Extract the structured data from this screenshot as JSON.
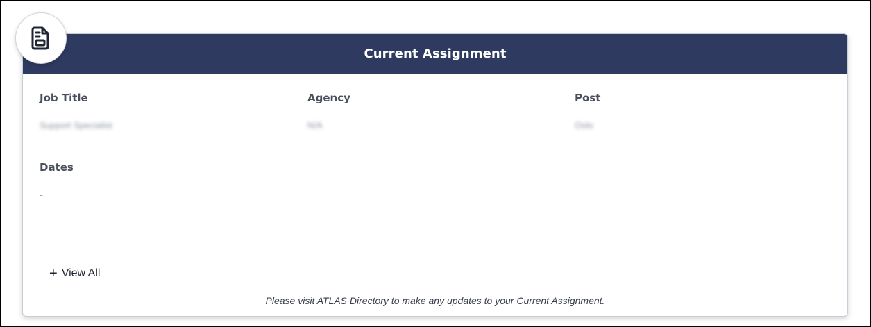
{
  "card": {
    "title": "Current Assignment",
    "icon": "document-icon",
    "header_color": "#2e3a60"
  },
  "fields": {
    "job_title": {
      "label": "Job Title",
      "value": "Support Specialist"
    },
    "agency": {
      "label": "Agency",
      "value": "N/A"
    },
    "post": {
      "label": "Post",
      "value": "Oslo"
    },
    "dates": {
      "label": "Dates",
      "value": "-"
    }
  },
  "footer": {
    "view_all_icon": "+",
    "view_all_label": "View All",
    "notice": "Please visit ATLAS Directory to make any updates to your Current Assignment."
  }
}
